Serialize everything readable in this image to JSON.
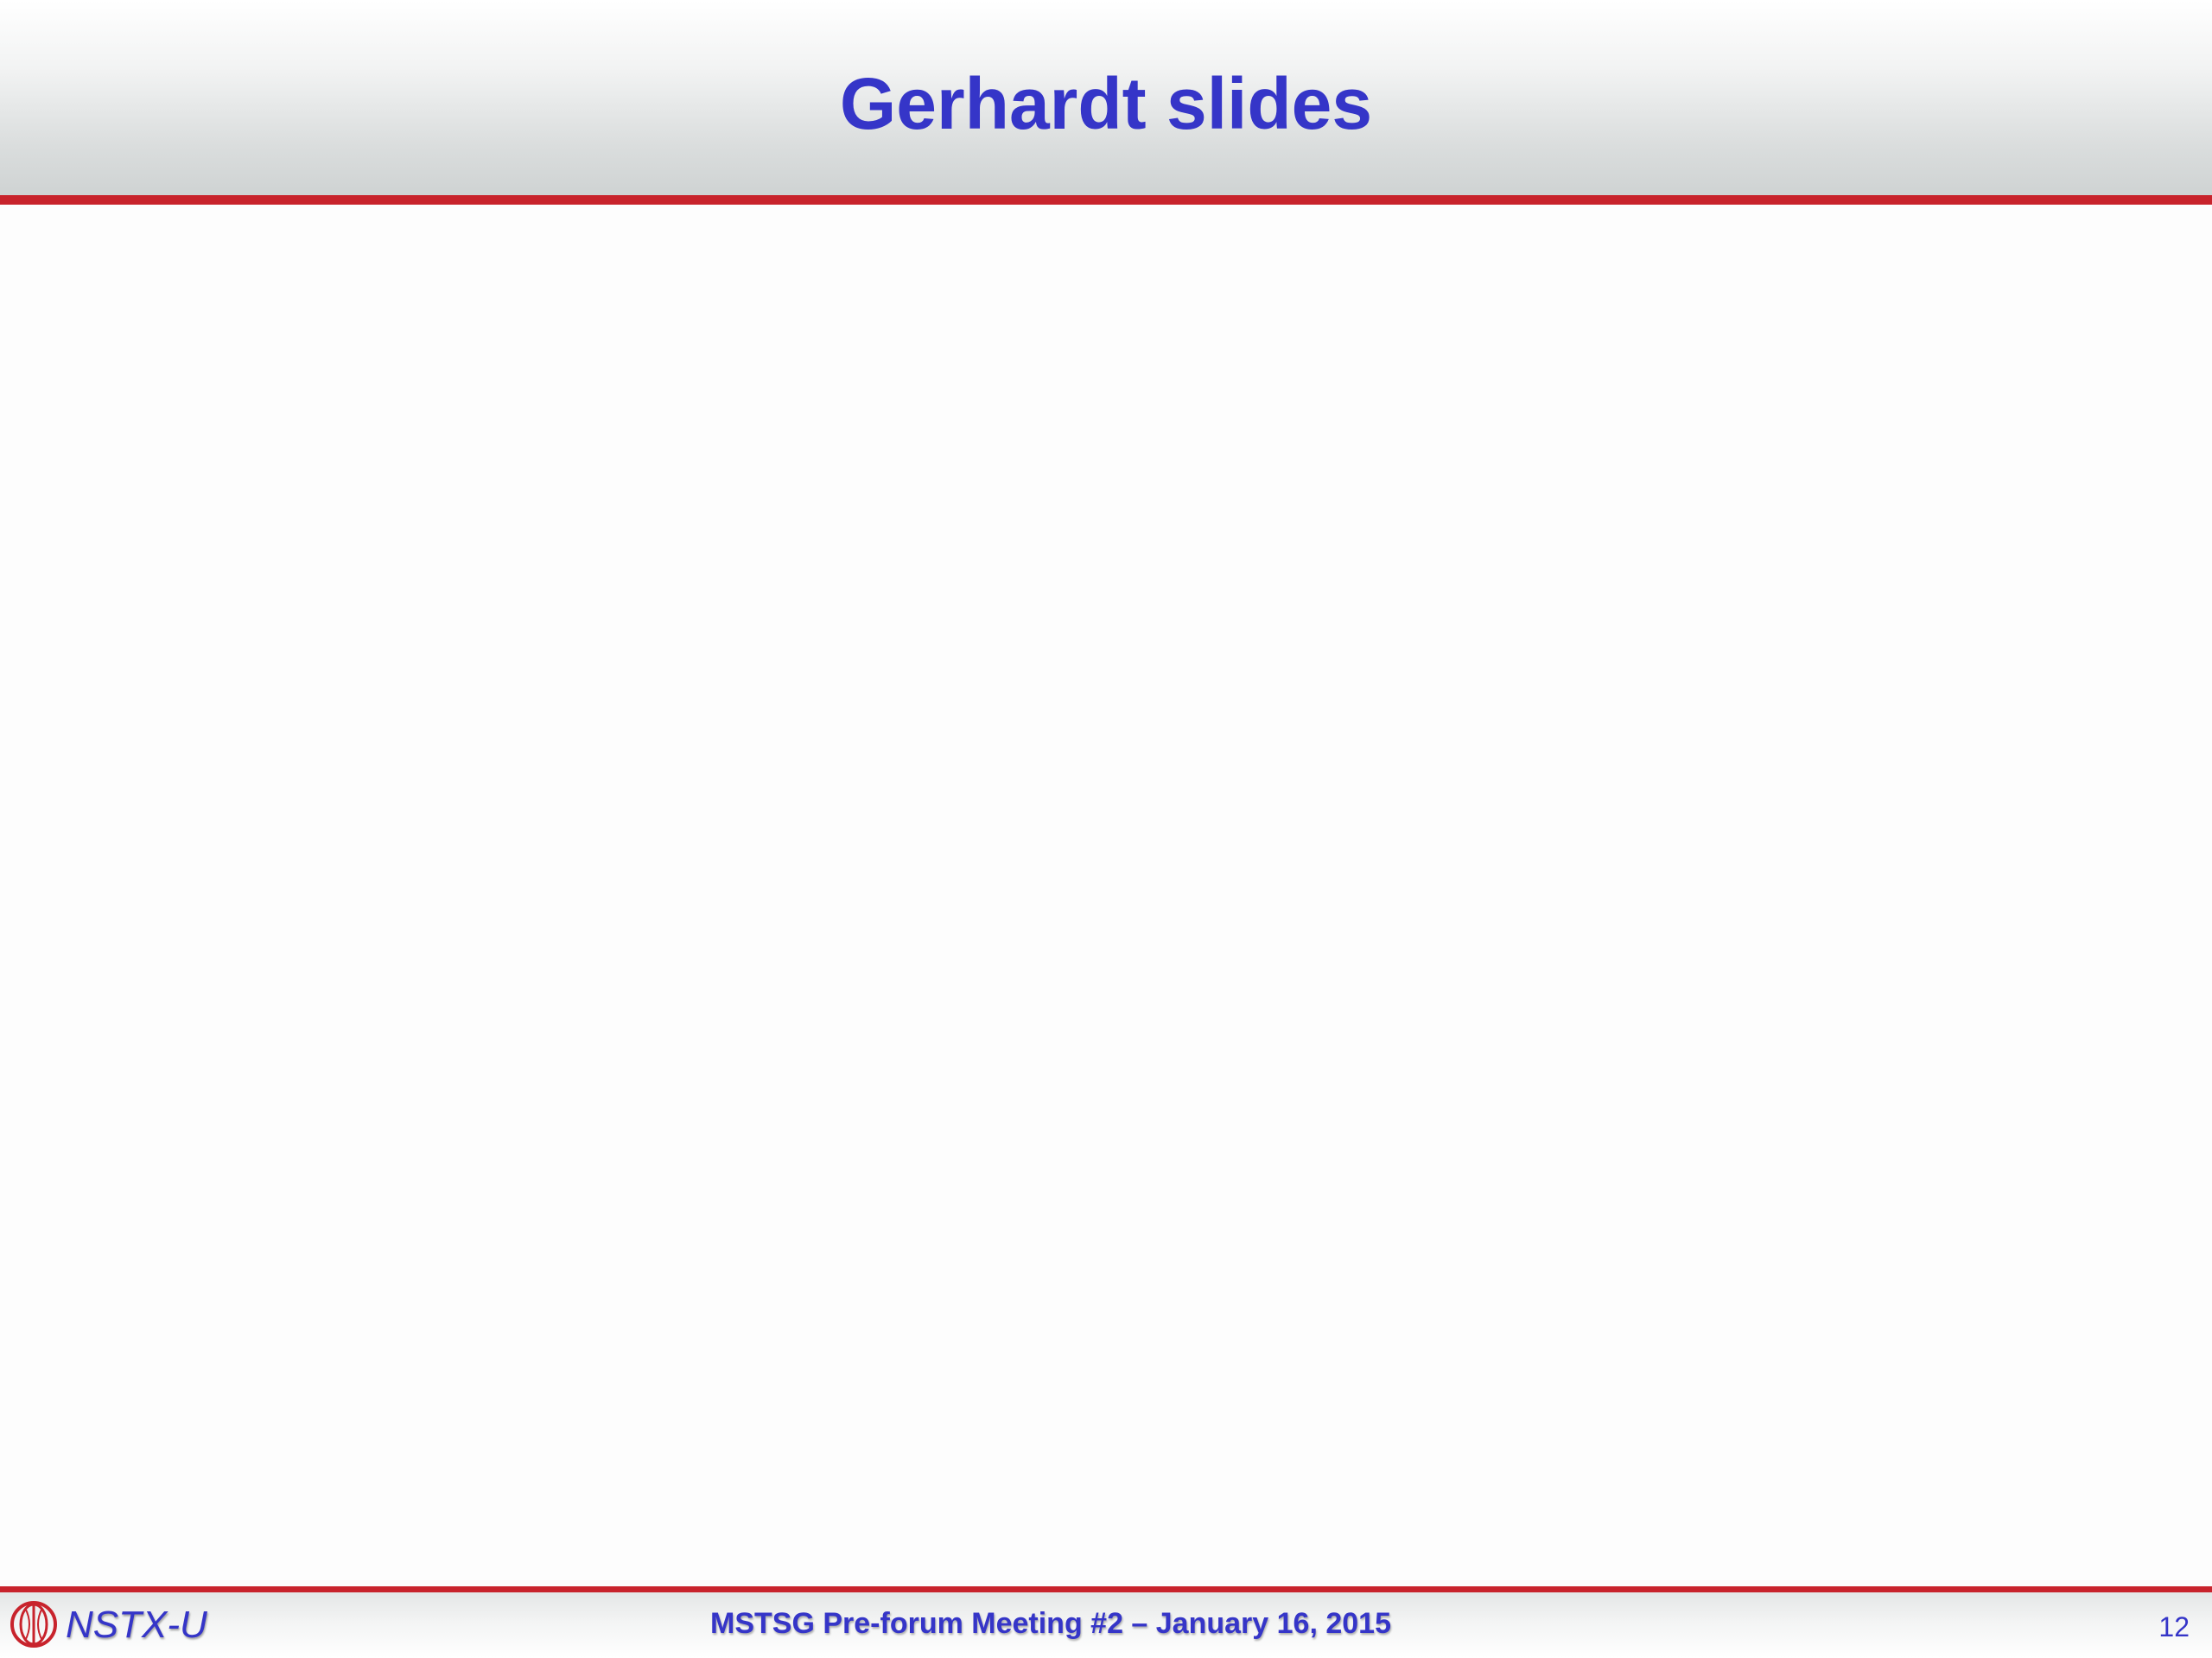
{
  "slide": {
    "title": "Gerhardt slides",
    "page_number": "12"
  },
  "footer": {
    "logo_text": "NSTX-U",
    "logo_icon": "nstx-u-logo-icon",
    "meeting": "MSTSG Pre-forum Meeting #2 – January 16, 2015"
  },
  "colors": {
    "title": "#3535c8",
    "accent_rule": "#c8232c",
    "background": "#fdfdfd"
  }
}
